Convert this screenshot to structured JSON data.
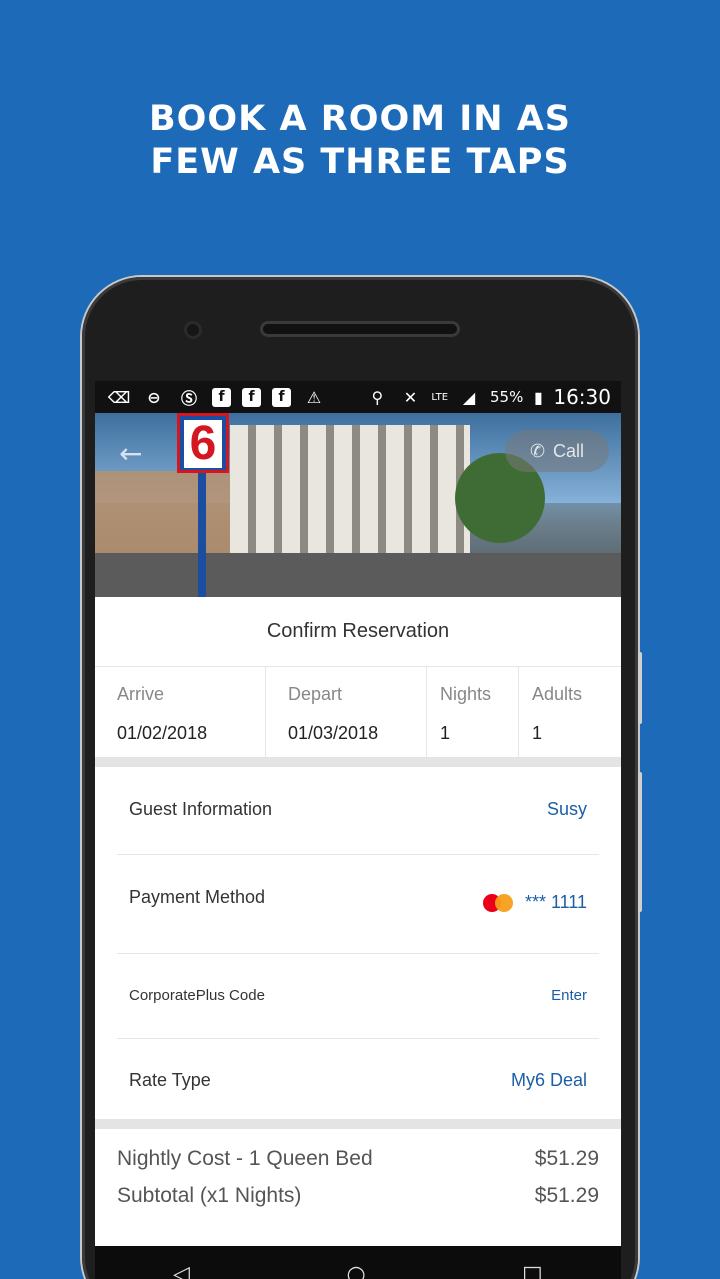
{
  "headline": {
    "line1": "BOOK A ROOM IN AS",
    "line2": "FEW AS THREE TAPS"
  },
  "statusbar": {
    "battery": "55%",
    "network": "LTE",
    "time": "16:30"
  },
  "hero": {
    "back_icon": "←",
    "sign_text": "6",
    "call_icon": "✆",
    "call_label": "Call"
  },
  "reservation": {
    "title": "Confirm Reservation",
    "dates": [
      {
        "label": "Arrive",
        "value": "01/02/2018"
      },
      {
        "label": "Depart",
        "value": "01/03/2018"
      },
      {
        "label": "Nights",
        "value": "1"
      },
      {
        "label": "Adults",
        "value": "1"
      }
    ],
    "rows": [
      {
        "label": "Guest Information",
        "value": "Susy"
      },
      {
        "label": "Payment Method",
        "value": "*** 1111"
      },
      {
        "label": "CorporatePlus Code",
        "value": "Enter"
      },
      {
        "label": "Rate Type",
        "value": "My6 Deal"
      }
    ],
    "costs": [
      {
        "label": "Nightly Cost - 1 Queen Bed",
        "value": "$51.29"
      },
      {
        "label": "Subtotal (x1 Nights)",
        "value": "$51.29"
      }
    ]
  },
  "navbar": {
    "back_icon": "◁",
    "home_icon": "○",
    "recents_icon": "□"
  },
  "colors": {
    "background": "#1d6ab8",
    "link": "#1c5fa5",
    "mastercard_red": "#eb001b",
    "mastercard_orange": "#f79e1b"
  }
}
